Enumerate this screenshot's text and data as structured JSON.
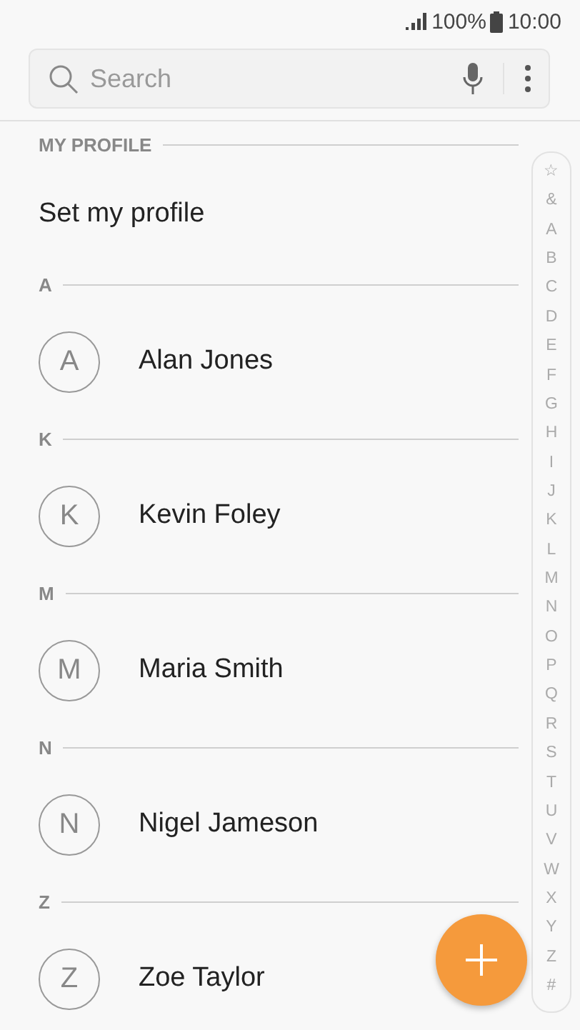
{
  "status_bar": {
    "battery": "100%",
    "time": "10:00"
  },
  "search": {
    "placeholder": "Search"
  },
  "profile": {
    "header": "MY PROFILE",
    "label": "Set my profile"
  },
  "sections": [
    {
      "letter": "A",
      "contacts": [
        {
          "initial": "A",
          "name": "Alan Jones"
        }
      ]
    },
    {
      "letter": "K",
      "contacts": [
        {
          "initial": "K",
          "name": "Kevin Foley"
        }
      ]
    },
    {
      "letter": "M",
      "contacts": [
        {
          "initial": "M",
          "name": "Maria Smith"
        }
      ]
    },
    {
      "letter": "N",
      "contacts": [
        {
          "initial": "N",
          "name": "Nigel Jameson"
        }
      ]
    },
    {
      "letter": "Z",
      "contacts": [
        {
          "initial": "Z",
          "name": "Zoe Taylor"
        }
      ]
    }
  ],
  "index": [
    "☆",
    "&",
    "A",
    "B",
    "C",
    "D",
    "E",
    "F",
    "G",
    "H",
    "I",
    "J",
    "K",
    "L",
    "M",
    "N",
    "O",
    "P",
    "Q",
    "R",
    "S",
    "T",
    "U",
    "V",
    "W",
    "X",
    "Y",
    "Z",
    "#"
  ]
}
